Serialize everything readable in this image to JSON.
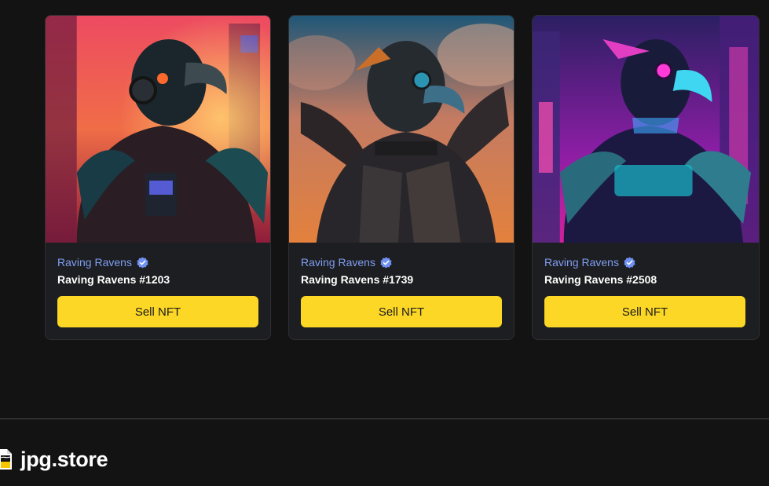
{
  "cards": [
    {
      "collection": "Raving Ravens",
      "name": "Raving Ravens #1203",
      "button_label": "Sell NFT",
      "verified_icon": "verified-badge-icon",
      "image_alt": "Raving Ravens #1203"
    },
    {
      "collection": "Raving Ravens",
      "name": "Raving Ravens #1739",
      "button_label": "Sell NFT",
      "verified_icon": "verified-badge-icon",
      "image_alt": "Raving Ravens #1739"
    },
    {
      "collection": "Raving Ravens",
      "name": "Raving Ravens #2508",
      "button_label": "Sell NFT",
      "verified_icon": "verified-badge-icon",
      "image_alt": "Raving Ravens #2508"
    }
  ],
  "footer": {
    "brand": "jpg.store",
    "logo_icon": "jpg-store-logo-icon"
  },
  "colors": {
    "background": "#131313",
    "card_background": "#1d1e21",
    "collection_link": "#7f9df1",
    "verified_badge": "#6f91f2",
    "button_fill": "#fcd726",
    "button_text": "#1b1b1b"
  }
}
